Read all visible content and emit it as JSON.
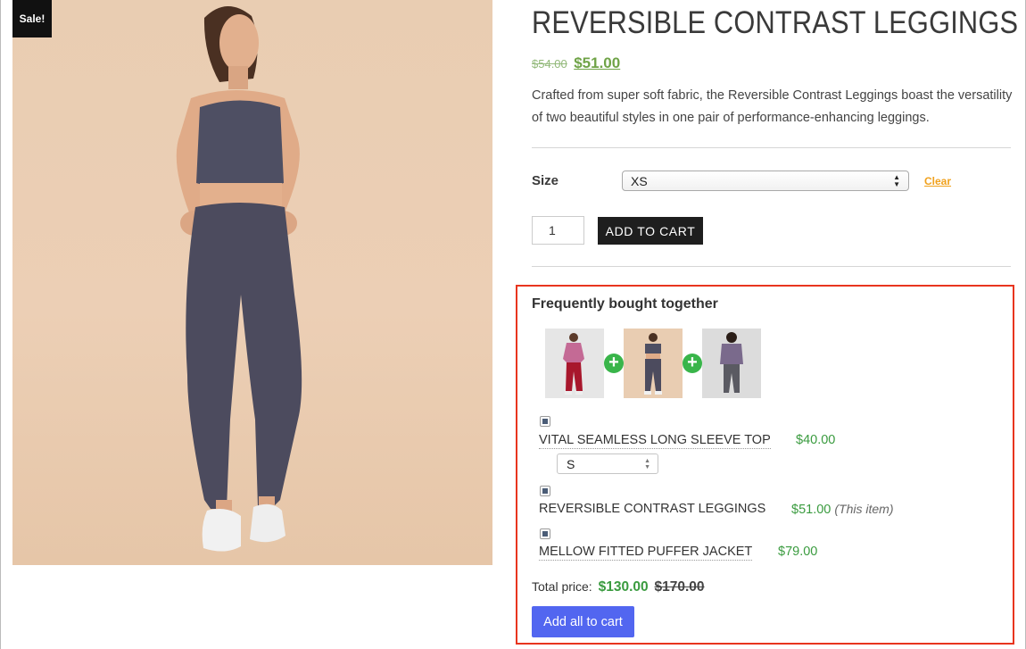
{
  "badge": {
    "label": "Sale!"
  },
  "product": {
    "title": "REVERSIBLE CONTRAST LEGGINGS",
    "old_price": "$54.00",
    "price": "$51.00",
    "description": "Crafted from super soft fabric, the Reversible Contrast Leggings boast the versatility of two beautiful styles in one pair of performance-enhancing leggings."
  },
  "variation": {
    "label": "Size",
    "selected": "XS",
    "clear_label": "Clear"
  },
  "cart": {
    "quantity": "1",
    "add_label": "ADD TO CART"
  },
  "fbt": {
    "title": "Frequently bought together",
    "items": [
      {
        "name": "VITAL SEAMLESS LONG SLEEVE TOP",
        "price": "$40.00",
        "variant": "S",
        "note": ""
      },
      {
        "name": "REVERSIBLE CONTRAST LEGGINGS",
        "price": "$51.00",
        "variant": "",
        "note": "(This item)"
      },
      {
        "name": "MELLOW FITTED PUFFER JACKET",
        "price": "$79.00",
        "variant": "",
        "note": ""
      }
    ],
    "total_label": "Total price:",
    "total_price": "$130.00",
    "total_old_price": "$170.00",
    "add_all_label": "Add all to cart"
  },
  "colors": {
    "accent_green": "#3a9b3f",
    "button_blue": "#5266f0",
    "highlight_red": "#e8351f",
    "clear_orange": "#f0a11d"
  }
}
